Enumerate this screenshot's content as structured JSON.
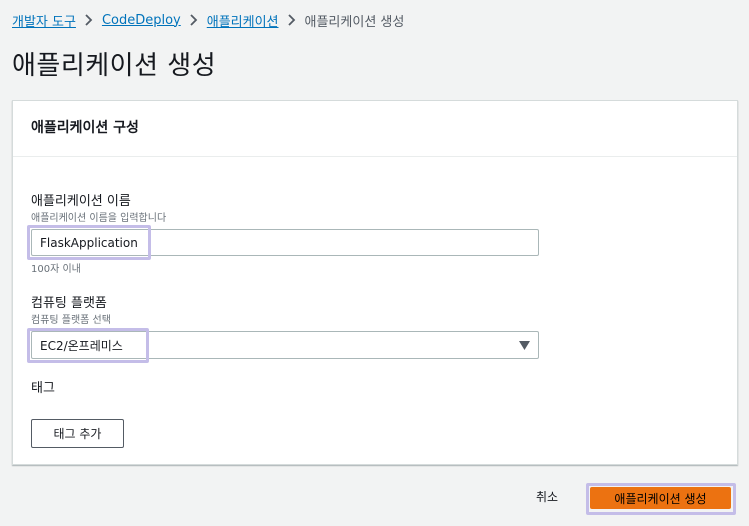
{
  "breadcrumb": {
    "items": [
      "개발자 도구",
      "CodeDeploy",
      "애플리케이션"
    ],
    "current": "애플리케이션 생성"
  },
  "page": {
    "title": "애플리케이션 생성"
  },
  "panel": {
    "title": "애플리케이션 구성",
    "app_name": {
      "label": "애플리케이션 이름",
      "description": "애플리케이션 이름을 입력합니다",
      "value": "FlaskApplication",
      "constraint": "100자 이내"
    },
    "platform": {
      "label": "컴퓨팅 플랫폼",
      "description": "컴퓨팅 플랫폼 선택",
      "selected": "EC2/온프레미스"
    },
    "tags": {
      "label": "태그",
      "add_button": "태그 추가"
    }
  },
  "actions": {
    "cancel": "취소",
    "create": "애플리케이션 생성"
  },
  "icons": {
    "separator": "chevron-right-icon",
    "dropdown": "caret-down-icon"
  },
  "colors": {
    "link": "#0073bb",
    "primary": "#ec7211",
    "highlight": "#c4bde8"
  }
}
